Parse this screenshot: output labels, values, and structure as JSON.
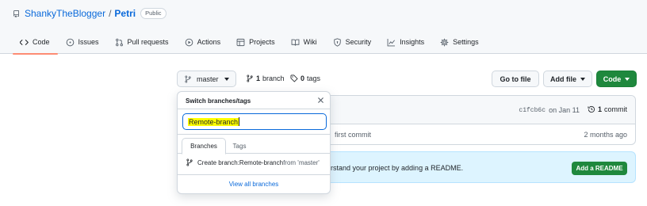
{
  "repo": {
    "owner": "ShankyTheBlogger",
    "separator": "/",
    "name": "Petri",
    "visibility": "Public"
  },
  "nav": {
    "tabs": [
      {
        "label": "Code",
        "icon": "code-icon",
        "active": true
      },
      {
        "label": "Issues",
        "icon": "issue-icon"
      },
      {
        "label": "Pull requests",
        "icon": "pull-request-icon"
      },
      {
        "label": "Actions",
        "icon": "play-icon"
      },
      {
        "label": "Projects",
        "icon": "table-icon"
      },
      {
        "label": "Wiki",
        "icon": "book-icon"
      },
      {
        "label": "Security",
        "icon": "shield-icon"
      },
      {
        "label": "Insights",
        "icon": "graph-icon"
      },
      {
        "label": "Settings",
        "icon": "gear-icon"
      }
    ]
  },
  "branch_bar": {
    "current_branch": "master",
    "branch_count": "1",
    "branch_label": "branch",
    "tag_count": "0",
    "tag_label": "tags",
    "go_to_file": "Go to file",
    "add_file": "Add file",
    "code": "Code"
  },
  "commit": {
    "sha": "c1fcb6c",
    "date": "on Jan 11",
    "count": "1",
    "count_label": "commit"
  },
  "file_row": {
    "message": "first commit",
    "age": "2 months ago"
  },
  "readme": {
    "text": "rstand your project by adding a README.",
    "button": "Add a README"
  },
  "dropdown": {
    "title": "Switch branches/tags",
    "filter_value": "Remote-branch",
    "tabs": {
      "branches": "Branches",
      "tags": "Tags"
    },
    "create_prefix": "Create branch: ",
    "create_name": "Remote-branch",
    "create_from": " from 'master'",
    "footer": "View all branches"
  },
  "colors": {
    "accent": "#0969da",
    "primary_button": "#1f883d",
    "active_tab_underline": "#fd8c73",
    "highlight": "#ffff00",
    "readme_banner": "#ddf4ff"
  }
}
